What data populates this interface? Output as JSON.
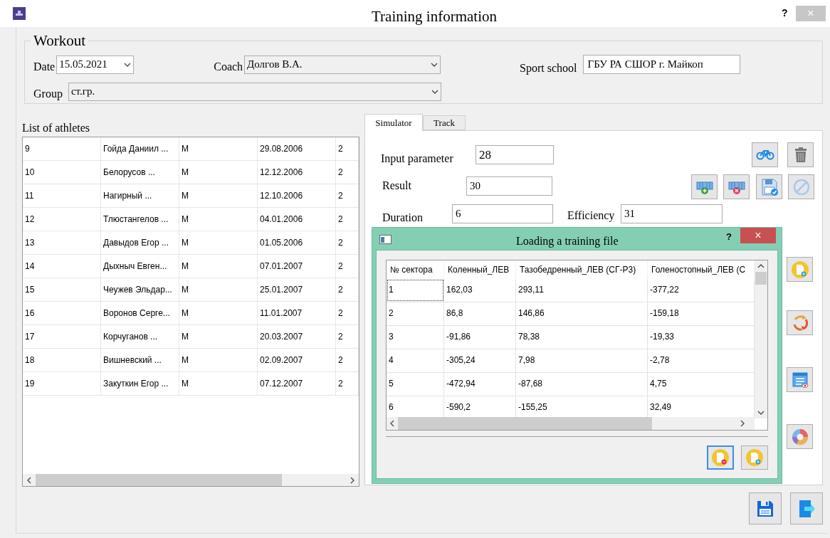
{
  "window": {
    "title": "Training information",
    "help": "?",
    "close": "×"
  },
  "workout": {
    "legend": "Workout",
    "date": {
      "label": "Date",
      "value": "15.05.2021"
    },
    "coach": {
      "label": "Coach",
      "value": "Долгов В.А."
    },
    "sport_school": {
      "label": "Sport school",
      "value": "ГБУ РА СШОР г. Майкоп"
    },
    "group": {
      "label": "Group",
      "value": "ст.гр."
    }
  },
  "athletes": {
    "label": "List of athletes",
    "rows": [
      [
        "9",
        "Гойда Даниил ...",
        "М",
        "29.08.2006",
        "2"
      ],
      [
        "10",
        "Белорусов ...",
        "М",
        "12.12.2006",
        "2"
      ],
      [
        "11",
        "Нагирный ...",
        "М",
        "12.10.2006",
        "2"
      ],
      [
        "12",
        "Тлюстангелов ...",
        "М",
        "04.01.2006",
        "2"
      ],
      [
        "13",
        "Давыдов Егор ...",
        "М",
        "01.05.2006",
        "2"
      ],
      [
        "14",
        "Дыхныч Евген...",
        "М",
        "07.01.2007",
        "2"
      ],
      [
        "15",
        "Чеужев Эльдар...",
        "М",
        "25.01.2007",
        "2"
      ],
      [
        "16",
        "Воронов Серге...",
        "М",
        "11.01.2007",
        "2"
      ],
      [
        "17",
        "Корчуганов ...",
        "М",
        "20.03.2007",
        "2"
      ],
      [
        "18",
        "Вишневский ...",
        "М",
        "02.09.2007",
        "2"
      ],
      [
        "19",
        "Закуткин Егор ...",
        "М",
        "07.12.2007",
        "2"
      ]
    ]
  },
  "tabs": [
    {
      "label": "Simulator",
      "selected": true
    },
    {
      "label": "Track",
      "selected": false
    }
  ],
  "simulator": {
    "input_parameter": {
      "label": "Input parameter",
      "value": "28"
    },
    "result": {
      "label": "Result",
      "value": "30"
    },
    "duration": {
      "label": "Duration",
      "value": "6"
    },
    "efficiency": {
      "label": "Efficiency",
      "value": "31"
    }
  },
  "dialog": {
    "title": "Loading a training file",
    "help": "?",
    "close": "×",
    "columns": [
      "№ сектора",
      "Коленный_ЛЕВ",
      "Тазобедренный_ЛЕВ (СГ-Р3)",
      "Голеностопный_ЛЕВ (С"
    ],
    "rows": [
      {
        "cells": [
          "1",
          "162,03",
          "293,11",
          "-377,22"
        ],
        "focused": true
      },
      {
        "cells": [
          "2",
          "86,8",
          "146,86",
          "-159,18"
        ],
        "focused": false
      },
      {
        "cells": [
          "3",
          "-91,86",
          "78,38",
          "-19,33"
        ],
        "focused": false
      },
      {
        "cells": [
          "4",
          "-305,24",
          "7,98",
          "-2,78"
        ],
        "focused": false
      },
      {
        "cells": [
          "5",
          "-472,94",
          "-87,68",
          "4,75"
        ],
        "focused": false
      },
      {
        "cells": [
          "6",
          "-590,2",
          "-155,25",
          "32,49"
        ],
        "focused": false
      }
    ],
    "buttons": [
      {
        "default": true
      },
      {
        "default": false
      }
    ]
  }
}
